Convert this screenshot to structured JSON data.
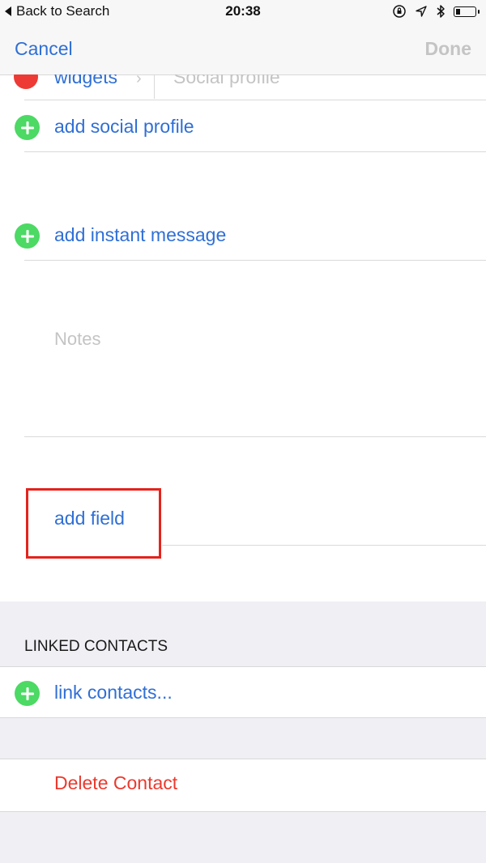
{
  "status_bar": {
    "back_label": "Back to Search",
    "time": "20:38",
    "icons": [
      "orientation-lock-icon",
      "location-icon",
      "bluetooth-icon",
      "battery-icon"
    ]
  },
  "nav": {
    "cancel_label": "Cancel",
    "done_label": "Done"
  },
  "partial_social_row": {
    "label": "widgets",
    "placeholder": "Social profile"
  },
  "rows": {
    "add_social_profile": "add social profile",
    "add_instant_message": "add instant message",
    "notes_placeholder": "Notes",
    "add_field": "add field"
  },
  "linked_contacts": {
    "header": "LINKED CONTACTS",
    "link_label": "link contacts..."
  },
  "delete_contact_label": "Delete Contact",
  "colors": {
    "accent": "#2f6fd6",
    "add_green": "#4cd964",
    "delete_red": "#ea3a2e",
    "highlight_red": "#e3241d"
  }
}
